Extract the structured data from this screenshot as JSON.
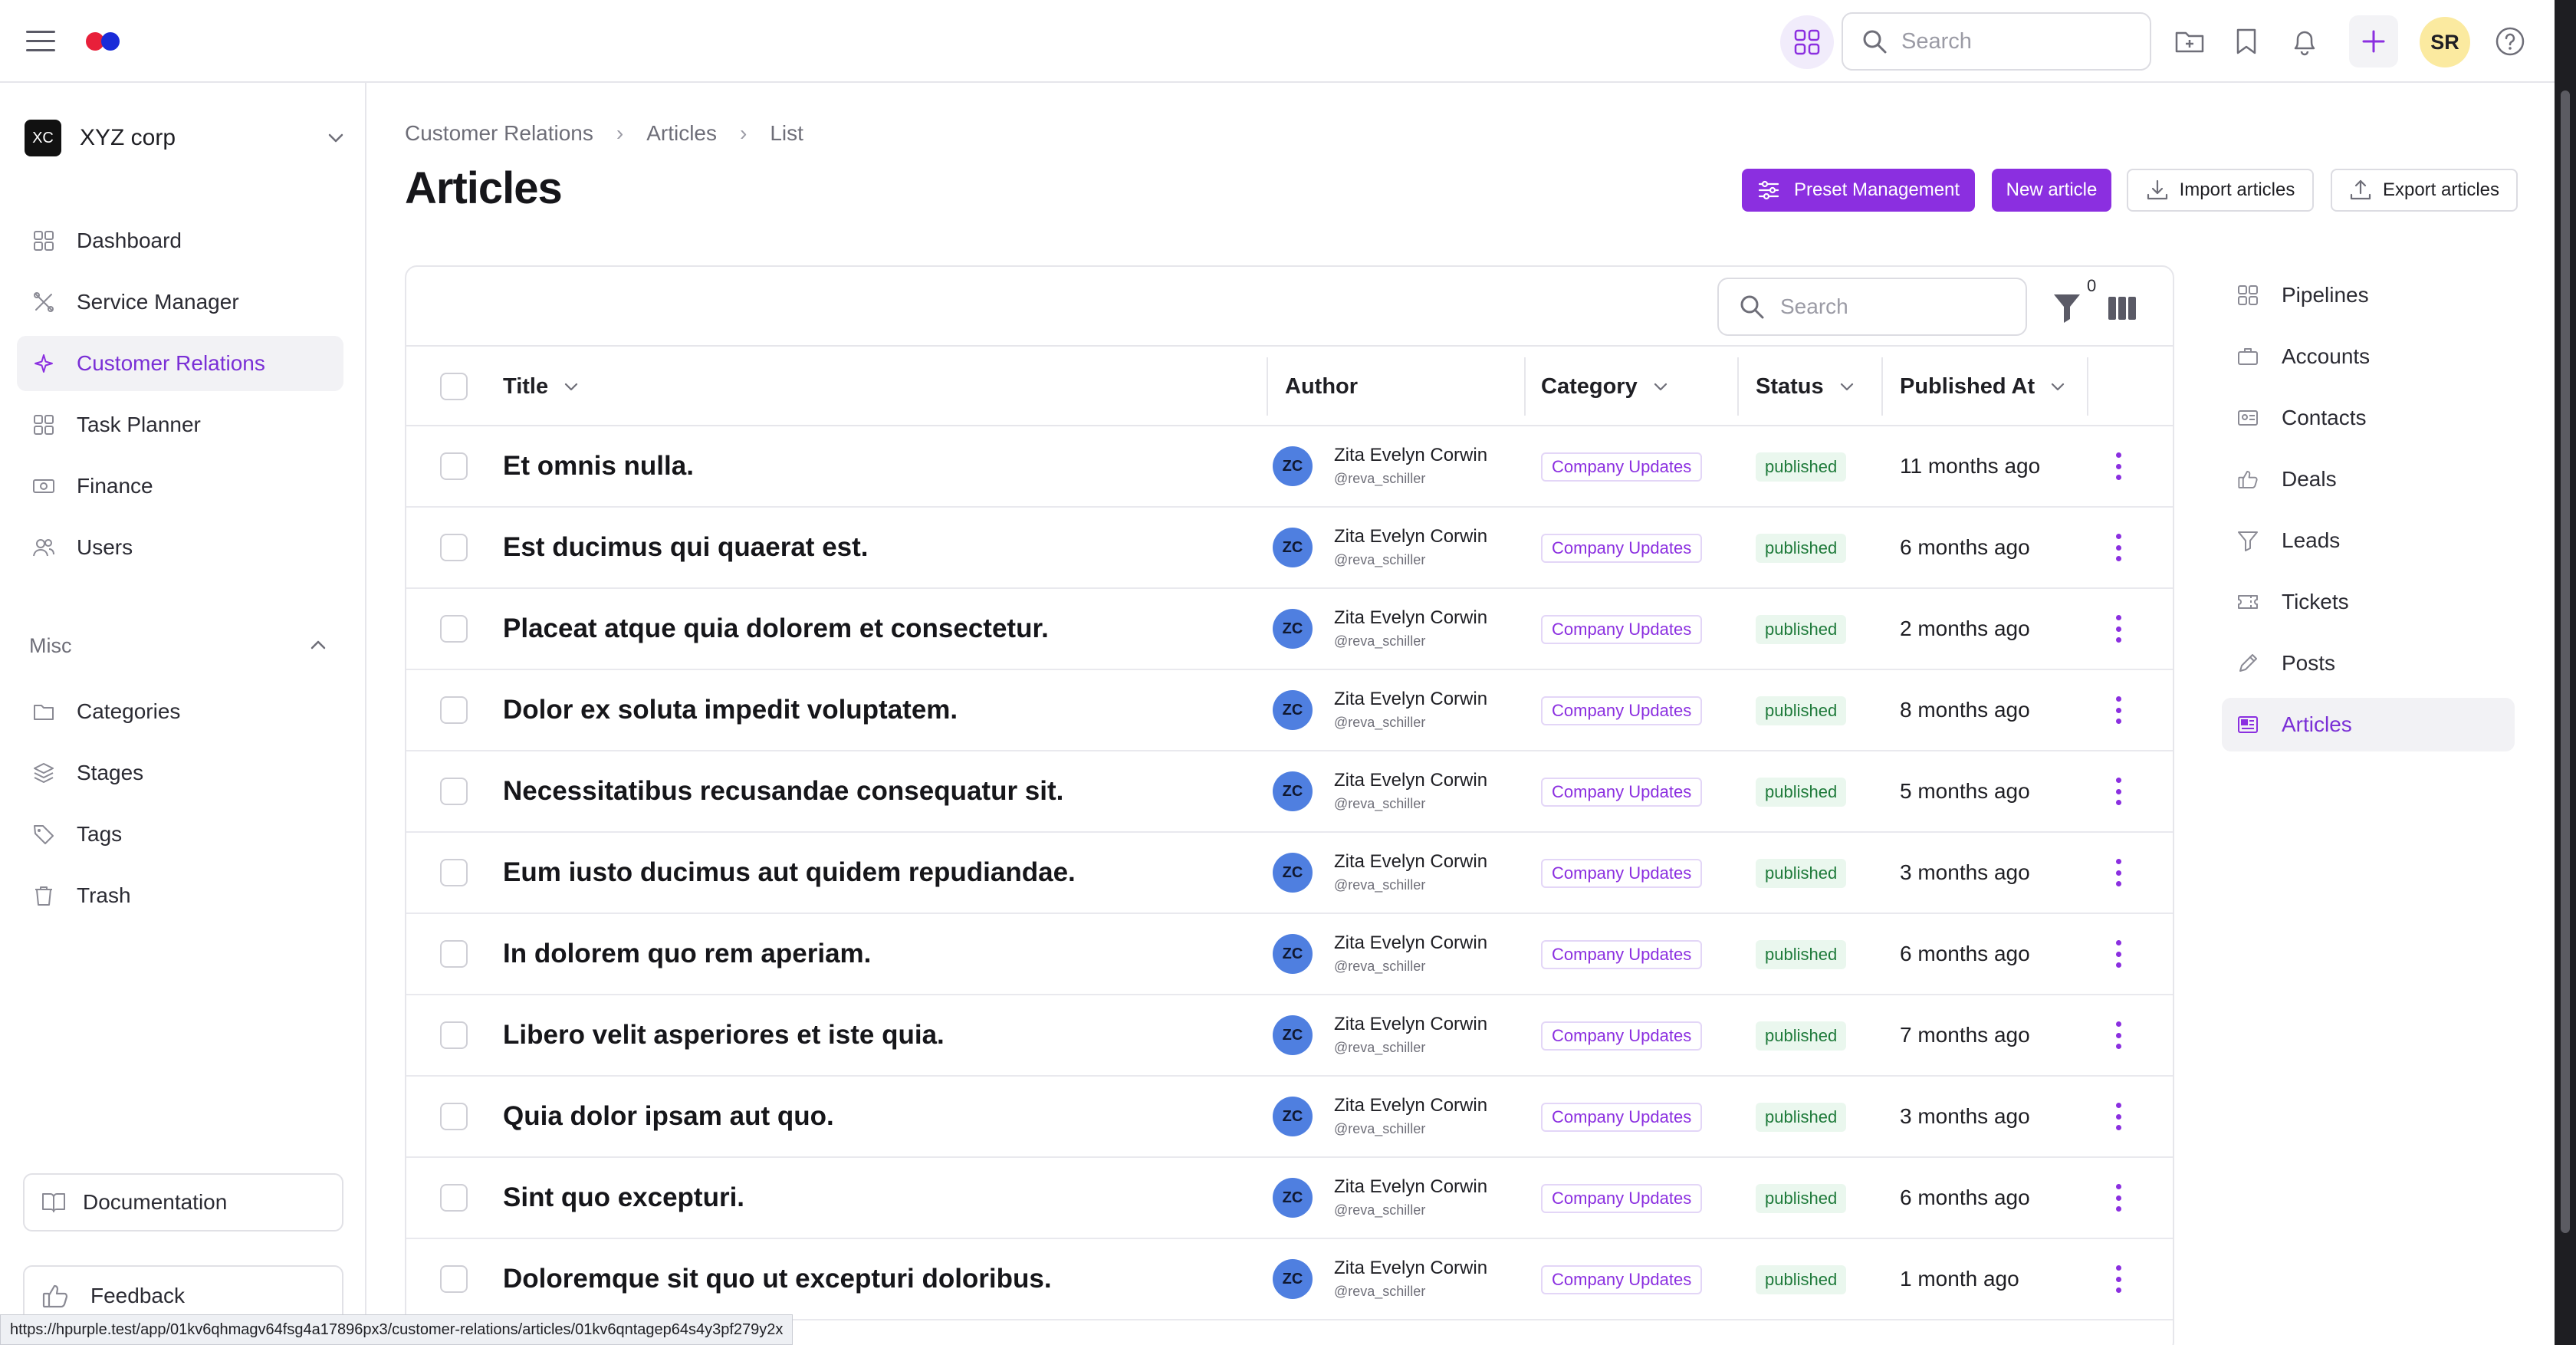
{
  "topbar": {
    "search_placeholder": "Search",
    "avatar_initials": "SR"
  },
  "sidebar": {
    "org_badge": "XC",
    "org_name": "XYZ corp",
    "items": [
      {
        "label": "Dashboard",
        "icon": "grid-icon"
      },
      {
        "label": "Service Manager",
        "icon": "tools-icon"
      },
      {
        "label": "Customer Relations",
        "icon": "sparkle-icon",
        "active": true
      },
      {
        "label": "Task Planner",
        "icon": "grid-icon"
      },
      {
        "label": "Finance",
        "icon": "money-icon"
      },
      {
        "label": "Users",
        "icon": "users-icon"
      }
    ],
    "misc_label": "Misc",
    "misc_items": [
      {
        "label": "Categories",
        "icon": "folder-icon"
      },
      {
        "label": "Stages",
        "icon": "layers-icon"
      },
      {
        "label": "Tags",
        "icon": "tag-icon"
      },
      {
        "label": "Trash",
        "icon": "trash-icon"
      }
    ],
    "documentation": "Documentation",
    "feedback": "Feedback"
  },
  "breadcrumb": [
    "Customer Relations",
    "Articles",
    "List"
  ],
  "page_title": "Articles",
  "actions": {
    "preset": "Preset Management",
    "new": "New article",
    "import": "Import articles",
    "export": "Export articles"
  },
  "table": {
    "search_placeholder": "Search",
    "filter_count": "0",
    "columns": [
      "Title",
      "Author",
      "Category",
      "Status",
      "Published At"
    ],
    "rows": [
      {
        "title": "Et omnis nulla.",
        "author_initials": "ZC",
        "author": "Zita Evelyn Corwin",
        "handle": "@reva_schiller",
        "category": "Company Updates",
        "status": "published",
        "published": "11 months ago"
      },
      {
        "title": "Est ducimus qui quaerat est.",
        "author_initials": "ZC",
        "author": "Zita Evelyn Corwin",
        "handle": "@reva_schiller",
        "category": "Company Updates",
        "status": "published",
        "published": "6 months ago"
      },
      {
        "title": "Placeat atque quia dolorem et consectetur.",
        "author_initials": "ZC",
        "author": "Zita Evelyn Corwin",
        "handle": "@reva_schiller",
        "category": "Company Updates",
        "status": "published",
        "published": "2 months ago"
      },
      {
        "title": "Dolor ex soluta impedit voluptatem.",
        "author_initials": "ZC",
        "author": "Zita Evelyn Corwin",
        "handle": "@reva_schiller",
        "category": "Company Updates",
        "status": "published",
        "published": "8 months ago"
      },
      {
        "title": "Necessitatibus recusandae consequatur sit.",
        "author_initials": "ZC",
        "author": "Zita Evelyn Corwin",
        "handle": "@reva_schiller",
        "category": "Company Updates",
        "status": "published",
        "published": "5 months ago"
      },
      {
        "title": "Eum iusto ducimus aut quidem repudiandae.",
        "author_initials": "ZC",
        "author": "Zita Evelyn Corwin",
        "handle": "@reva_schiller",
        "category": "Company Updates",
        "status": "published",
        "published": "3 months ago"
      },
      {
        "title": "In dolorem quo rem aperiam.",
        "author_initials": "ZC",
        "author": "Zita Evelyn Corwin",
        "handle": "@reva_schiller",
        "category": "Company Updates",
        "status": "published",
        "published": "6 months ago"
      },
      {
        "title": "Libero velit asperiores et iste quia.",
        "author_initials": "ZC",
        "author": "Zita Evelyn Corwin",
        "handle": "@reva_schiller",
        "category": "Company Updates",
        "status": "published",
        "published": "7 months ago"
      },
      {
        "title": "Quia dolor ipsam aut quo.",
        "author_initials": "ZC",
        "author": "Zita Evelyn Corwin",
        "handle": "@reva_schiller",
        "category": "Company Updates",
        "status": "published",
        "published": "3 months ago"
      },
      {
        "title": "Sint quo excepturi.",
        "author_initials": "ZC",
        "author": "Zita Evelyn Corwin",
        "handle": "@reva_schiller",
        "category": "Company Updates",
        "status": "published",
        "published": "6 months ago"
      },
      {
        "title": "Doloremque sit quo ut excepturi doloribus.",
        "author_initials": "ZC",
        "author": "Zita Evelyn Corwin",
        "handle": "@reva_schiller",
        "category": "Company Updates",
        "status": "published",
        "published": "1 month ago"
      }
    ]
  },
  "right_nav": [
    {
      "label": "Pipelines",
      "icon": "grid-icon"
    },
    {
      "label": "Accounts",
      "icon": "briefcase-icon"
    },
    {
      "label": "Contacts",
      "icon": "contact-card-icon"
    },
    {
      "label": "Deals",
      "icon": "thumbs-up-icon"
    },
    {
      "label": "Leads",
      "icon": "funnel-icon"
    },
    {
      "label": "Tickets",
      "icon": "ticket-icon"
    },
    {
      "label": "Posts",
      "icon": "pencil-icon"
    },
    {
      "label": "Articles",
      "icon": "article-icon",
      "active": true
    }
  ],
  "status_url": "https://hpurple.test/app/01kv6qhmagv64fsg4a17896px3/customer-relations/articles/01kv6qntagep64s4y3pf279y2x",
  "colors": {
    "accent": "#8b2fe0",
    "status_green": "#1e7a3a"
  }
}
